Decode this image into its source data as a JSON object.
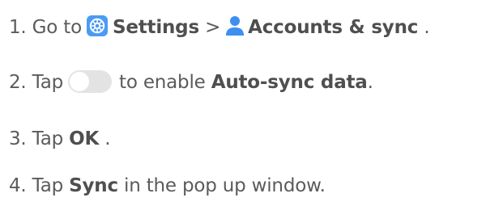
{
  "steps": [
    {
      "number": "1.",
      "prefix": "Go to",
      "settings_label": "Settings",
      "separator": ">",
      "accounts_label": "Accounts & sync",
      "suffix": "."
    },
    {
      "number": "2.",
      "prefix": "Tap",
      "middle": "to enable",
      "bold_label": "Auto-sync data",
      "suffix": "."
    },
    {
      "number": "3.",
      "prefix": "Tap",
      "bold_label": "OK",
      "suffix": "."
    },
    {
      "number": "4.",
      "prefix": "Tap",
      "bold_label": "Sync",
      "suffix": "in the pop up window."
    }
  ],
  "icons": {
    "settings": "gear-icon",
    "accounts": "person-icon",
    "toggle": "toggle-switch-off"
  },
  "colors": {
    "text": "#5b5b5b",
    "settings_icon": "#4b9bf4",
    "account_icon": "#3f8ff0",
    "toggle_track": "#e3e3e3"
  }
}
